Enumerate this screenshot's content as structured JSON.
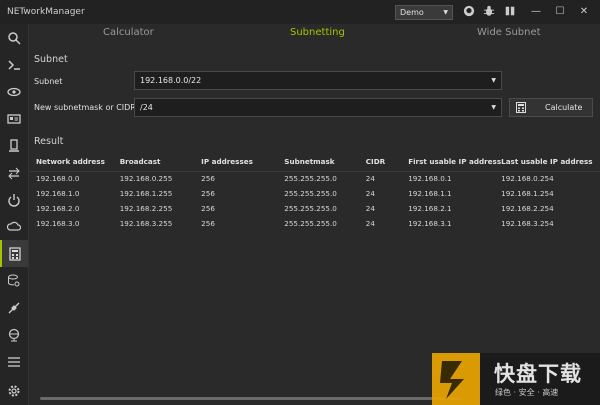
{
  "app": {
    "title": "NETworkManager"
  },
  "titlebar": {
    "profile": "Demo"
  },
  "tabs": [
    {
      "label": "Calculator",
      "active": false
    },
    {
      "label": "Subnetting",
      "active": true
    },
    {
      "label": "Wide Subnet",
      "active": false
    }
  ],
  "subnet_section": {
    "title": "Subnet",
    "subnet_label": "Subnet",
    "subnet_value": "192.168.0.0/22",
    "new_mask_label": "New subnetmask or CIDR",
    "new_mask_value": "/24",
    "calculate_label": "Calculate"
  },
  "result": {
    "title": "Result",
    "columns": [
      "Network address",
      "Broadcast",
      "IP addresses",
      "Subnetmask",
      "CIDR",
      "First usable IP address",
      "Last usable IP address"
    ],
    "rows": [
      [
        "192.168.0.0",
        "192.168.0.255",
        "256",
        "255.255.255.0",
        "24",
        "192.168.0.1",
        "192.168.0.254"
      ],
      [
        "192.168.1.0",
        "192.168.1.255",
        "256",
        "255.255.255.0",
        "24",
        "192.168.1.1",
        "192.168.1.254"
      ],
      [
        "192.168.2.0",
        "192.168.2.255",
        "256",
        "255.255.255.0",
        "24",
        "192.168.2.1",
        "192.168.2.254"
      ],
      [
        "192.168.3.0",
        "192.168.3.255",
        "256",
        "255.255.255.0",
        "24",
        "192.168.3.1",
        "192.168.3.254"
      ]
    ]
  },
  "watermark": {
    "big": "快盘下载",
    "small": "绿色 · 安全 · 高速"
  },
  "colors": {
    "accent": "#a4c400",
    "background": "#2a2a2a"
  }
}
